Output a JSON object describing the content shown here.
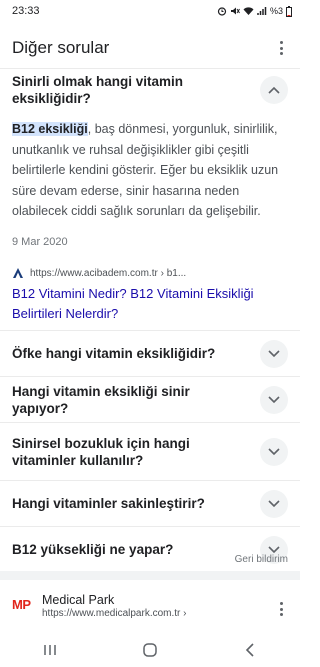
{
  "status_bar": {
    "time": "23:33",
    "battery": "%3"
  },
  "card": {
    "title": "Diğer sorular",
    "expanded_question": {
      "text": "Sinirli olmak hangi vitamin eksikliğidir?",
      "answer_highlight": "B12 eksikliği",
      "answer_rest": ", baş dönmesi, yorgunluk, sinirlilik, unutkanlık ve ruhsal değişiklikler gibi çeşitli belirtilerle kendini gösterir. Eğer bu eksiklik uzun süre devam ederse, sinir hasarına neden olabilecek ciddi sağlık sorunları da gelişebilir.",
      "date": "9 Mar 2020",
      "source_url": "https://www.acibadem.com.tr › b1...",
      "source_title": "B12 Vitamini Nedir? B12 Vitamini Eksikliği Belirtileri Nelerdir?"
    },
    "questions": [
      {
        "text": "Öfke hangi vitamin eksikliğidir?"
      },
      {
        "text": "Hangi vitamin eksikliği sinir yapıyor?"
      },
      {
        "text": "Sinirsel bozukluk için hangi vitaminler kullanılır?"
      },
      {
        "text": "Hangi vitaminler sakinleştirir?"
      },
      {
        "text": "B12 yüksekliği ne yapar?"
      }
    ],
    "feedback_label": "Geri bildirim"
  },
  "result": {
    "logo_text": "MP",
    "site_name": "Medical Park",
    "url": "https://www.medicalpark.com.tr ›"
  },
  "colors": {
    "link": "#1a0dab",
    "highlight": "#d2e3fc",
    "logo_red": "#e1261c"
  }
}
